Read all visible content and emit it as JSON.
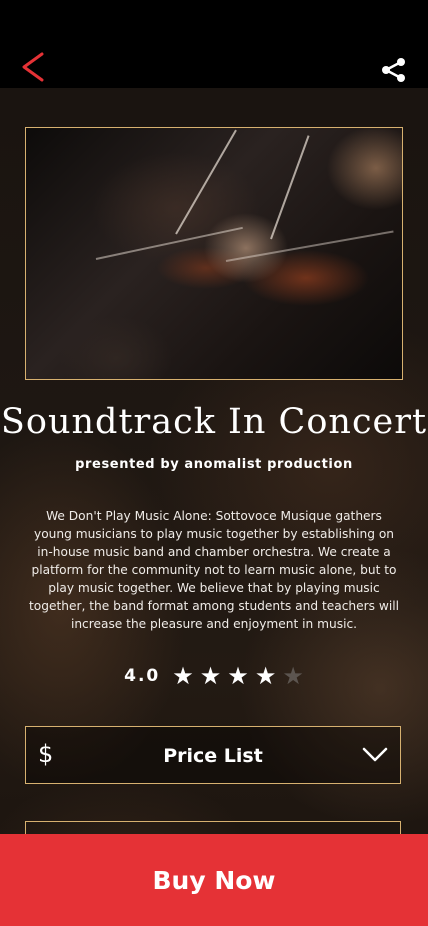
{
  "header": {
    "back_icon": "chevron-left-icon",
    "share_icon": "share-icon",
    "accent_color": "#e53236"
  },
  "event": {
    "title": "Soundtrack In Concert",
    "subtitle": "presented by anomalist production",
    "description": "We Don't Play Music Alone: Sottovoce Musique gathers young musicians to play music together by establishing on in-house music band and chamber orchestra. We create a platform for the community not to learn music alone, but to play music together. We believe that by playing music together, the band format among students and teachers will increase the pleasure and enjoyment in music.",
    "image_icon": "orchestra-photo",
    "border_color": "#d7b170"
  },
  "rating": {
    "value": "4.0",
    "stars_filled": 4,
    "stars_total": 5
  },
  "price_list": {
    "icon": "dollar-icon",
    "label": "Price List",
    "chevron_icon": "chevron-down-icon"
  },
  "cta": {
    "label": "Buy Now",
    "color": "#e53236"
  }
}
